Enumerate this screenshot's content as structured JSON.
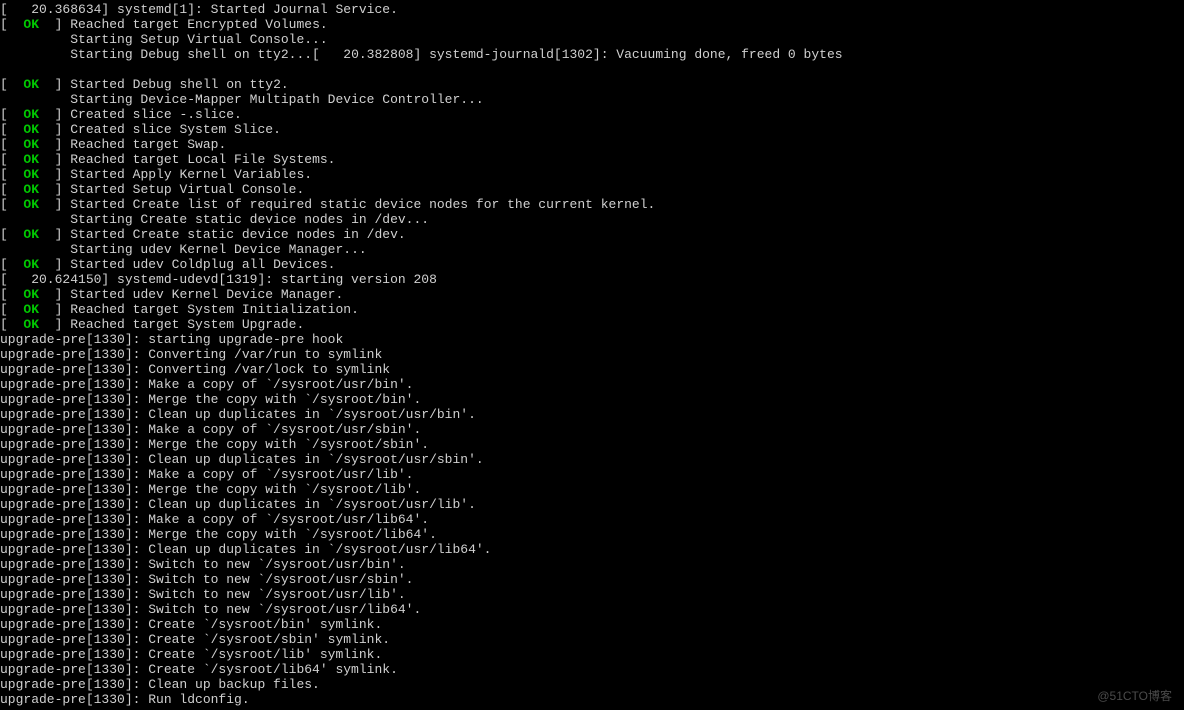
{
  "watermark": "@51CTO博客",
  "lines": [
    {
      "type": "plain",
      "text": "[   20.368634] systemd[1]: Started Journal Service."
    },
    {
      "type": "ok",
      "text": "Reached target Encrypted Volumes."
    },
    {
      "type": "indent",
      "text": "Starting Setup Virtual Console..."
    },
    {
      "type": "indent",
      "text": "Starting Debug shell on tty2...[   20.382808] systemd-journald[1302]: Vacuuming done, freed 0 bytes"
    },
    {
      "type": "blank",
      "text": ""
    },
    {
      "type": "ok",
      "text": "Started Debug shell on tty2."
    },
    {
      "type": "indent",
      "text": "Starting Device-Mapper Multipath Device Controller..."
    },
    {
      "type": "ok",
      "text": "Created slice -.slice."
    },
    {
      "type": "ok",
      "text": "Created slice System Slice."
    },
    {
      "type": "ok",
      "text": "Reached target Swap."
    },
    {
      "type": "ok",
      "text": "Reached target Local File Systems."
    },
    {
      "type": "ok",
      "text": "Started Apply Kernel Variables."
    },
    {
      "type": "ok",
      "text": "Started Setup Virtual Console."
    },
    {
      "type": "ok",
      "text": "Started Create list of required static device nodes for the current kernel."
    },
    {
      "type": "indent",
      "text": "Starting Create static device nodes in /dev..."
    },
    {
      "type": "ok",
      "text": "Started Create static device nodes in /dev."
    },
    {
      "type": "indent",
      "text": "Starting udev Kernel Device Manager..."
    },
    {
      "type": "ok",
      "text": "Started udev Coldplug all Devices."
    },
    {
      "type": "plain",
      "text": "[   20.624150] systemd-udevd[1319]: starting version 208"
    },
    {
      "type": "ok",
      "text": "Started udev Kernel Device Manager."
    },
    {
      "type": "ok",
      "text": "Reached target System Initialization."
    },
    {
      "type": "ok",
      "text": "Reached target System Upgrade."
    },
    {
      "type": "plain",
      "text": "upgrade-pre[1330]: starting upgrade-pre hook"
    },
    {
      "type": "plain",
      "text": "upgrade-pre[1330]: Converting /var/run to symlink"
    },
    {
      "type": "plain",
      "text": "upgrade-pre[1330]: Converting /var/lock to symlink"
    },
    {
      "type": "plain",
      "text": "upgrade-pre[1330]: Make a copy of `/sysroot/usr/bin'."
    },
    {
      "type": "plain",
      "text": "upgrade-pre[1330]: Merge the copy with `/sysroot/bin'."
    },
    {
      "type": "plain",
      "text": "upgrade-pre[1330]: Clean up duplicates in `/sysroot/usr/bin'."
    },
    {
      "type": "plain",
      "text": "upgrade-pre[1330]: Make a copy of `/sysroot/usr/sbin'."
    },
    {
      "type": "plain",
      "text": "upgrade-pre[1330]: Merge the copy with `/sysroot/sbin'."
    },
    {
      "type": "plain",
      "text": "upgrade-pre[1330]: Clean up duplicates in `/sysroot/usr/sbin'."
    },
    {
      "type": "plain",
      "text": "upgrade-pre[1330]: Make a copy of `/sysroot/usr/lib'."
    },
    {
      "type": "plain",
      "text": "upgrade-pre[1330]: Merge the copy with `/sysroot/lib'."
    },
    {
      "type": "plain",
      "text": "upgrade-pre[1330]: Clean up duplicates in `/sysroot/usr/lib'."
    },
    {
      "type": "plain",
      "text": "upgrade-pre[1330]: Make a copy of `/sysroot/usr/lib64'."
    },
    {
      "type": "plain",
      "text": "upgrade-pre[1330]: Merge the copy with `/sysroot/lib64'."
    },
    {
      "type": "plain",
      "text": "upgrade-pre[1330]: Clean up duplicates in `/sysroot/usr/lib64'."
    },
    {
      "type": "plain",
      "text": "upgrade-pre[1330]: Switch to new `/sysroot/usr/bin'."
    },
    {
      "type": "plain",
      "text": "upgrade-pre[1330]: Switch to new `/sysroot/usr/sbin'."
    },
    {
      "type": "plain",
      "text": "upgrade-pre[1330]: Switch to new `/sysroot/usr/lib'."
    },
    {
      "type": "plain",
      "text": "upgrade-pre[1330]: Switch to new `/sysroot/usr/lib64'."
    },
    {
      "type": "plain",
      "text": "upgrade-pre[1330]: Create `/sysroot/bin' symlink."
    },
    {
      "type": "plain",
      "text": "upgrade-pre[1330]: Create `/sysroot/sbin' symlink."
    },
    {
      "type": "plain",
      "text": "upgrade-pre[1330]: Create `/sysroot/lib' symlink."
    },
    {
      "type": "plain",
      "text": "upgrade-pre[1330]: Create `/sysroot/lib64' symlink."
    },
    {
      "type": "plain",
      "text": "upgrade-pre[1330]: Clean up backup files."
    },
    {
      "type": "plain",
      "text": "upgrade-pre[1330]: Run ldconfig."
    }
  ]
}
